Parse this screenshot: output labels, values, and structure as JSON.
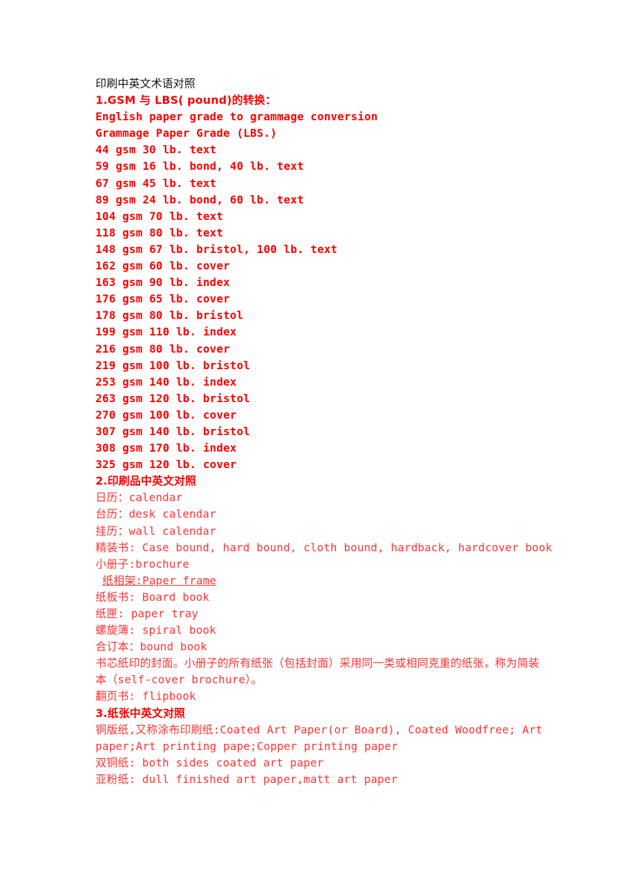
{
  "document": {
    "title": "印刷中英文术语对照",
    "section1": {
      "heading": "1.GSM 与 LBS( pound)的转换：",
      "subtitle1": "English paper grade to grammage conversion",
      "subtitle2": "Grammage Paper Grade (LBS.)",
      "rows": [
        "44 gsm 30 lb. text",
        "59 gsm 16 lb. bond, 40 lb. text",
        "67 gsm 45 lb. text",
        "89 gsm 24 lb. bond, 60 lb. text",
        "104 gsm 70 lb. text",
        "118 gsm 80 lb. text",
        "148 gsm 67 lb. bristol, 100 lb. text",
        "162 gsm 60 lb. cover",
        "163 gsm 90 lb. index",
        "176 gsm 65 lb. cover",
        "178 gsm 80 lb. bristol",
        "199 gsm 110 lb. index",
        "216 gsm 80 lb. cover",
        "219 gsm 100 lb. bristol",
        "253 gsm 140 lb. index",
        "263 gsm 120 lb. bristol",
        "270 gsm 100 lb. cover",
        "307 gsm 140 lb. bristol",
        "308 gsm 170 lb. index",
        "325 gsm 120 lb. cover"
      ]
    },
    "section2": {
      "heading": "2.印刷品中英文对照",
      "items": [
        "日历：calendar",
        "台历：desk calendar",
        "挂历：wall calendar",
        "精装书: Case bound, hard bound, cloth bound, hardback, hardcover book",
        "小册子:brochure",
        "纸相架:Paper frame",
        "纸板书: Board book",
        "纸匣: paper tray",
        "螺旋簿: spiral book",
        "合订本：bound book",
        "书芯纸印的封面。小册子的所有纸张（包括封面）采用同一类或相同克重的纸张，称为简装本（self-cover brochure）。",
        "翻页书: flipbook"
      ]
    },
    "section3": {
      "heading": "3.纸张中英文对照",
      "items": [
        "铜版纸,又称涂布印刷纸:Coated Art Paper(or Board), Coated Woodfree; Art paper;Art printing pape;Copper printing paper",
        "双铜纸: both sides coated art paper",
        "亚粉纸: dull finished art paper,matt art paper"
      ]
    },
    "colors": {
      "title": "#111111",
      "heading_red": "#ff0000",
      "body_red": "#ff3333",
      "background": "#ffffff"
    }
  }
}
